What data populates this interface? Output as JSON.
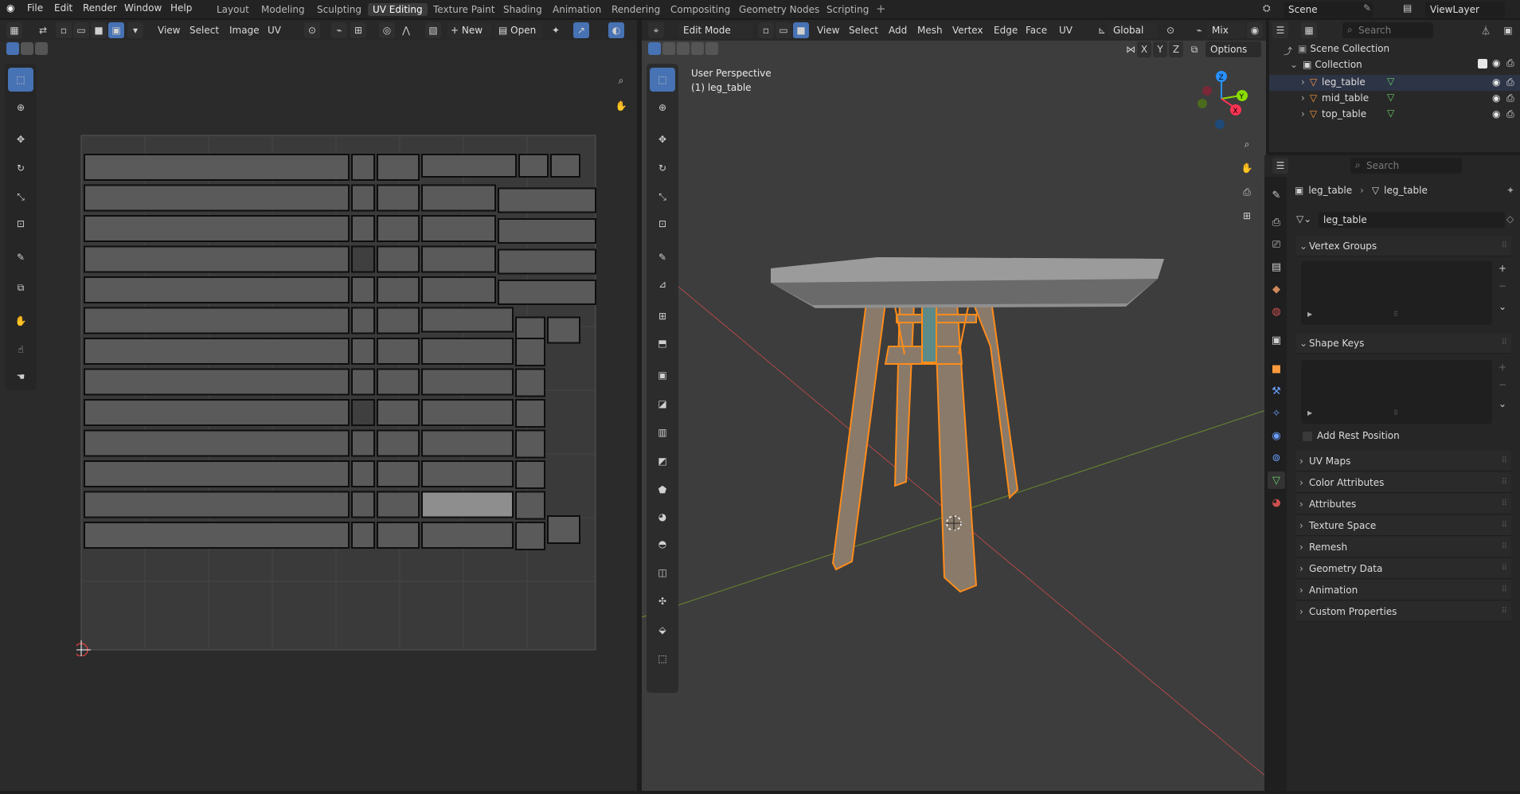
{
  "topbar": {
    "menus": [
      "File",
      "Edit",
      "Render",
      "Window",
      "Help"
    ],
    "workspaces": [
      "Layout",
      "Modeling",
      "Sculpting",
      "UV Editing",
      "Texture Paint",
      "Shading",
      "Animation",
      "Rendering",
      "Compositing",
      "Geometry Nodes",
      "Scripting"
    ],
    "active_workspace": "UV Editing",
    "scene": "Scene",
    "view_layer": "ViewLayer"
  },
  "uv_editor": {
    "menus": [
      "View",
      "Select",
      "Image",
      "UV"
    ],
    "new_label": "New",
    "open_label": "Open"
  },
  "viewport": {
    "mode": "Edit Mode",
    "menus": [
      "View",
      "Select",
      "Add",
      "Mesh",
      "Vertex",
      "Edge",
      "Face",
      "UV"
    ],
    "transform_orientation": "Global",
    "snap_mode": "Mix",
    "options_label": "Options",
    "axes": [
      "X",
      "Y",
      "Z"
    ],
    "overlay_title": "User Perspective",
    "overlay_object": "(1) leg_table",
    "gizmo_axes": [
      "X",
      "Y",
      "Z"
    ]
  },
  "outliner": {
    "search_placeholder": "Search",
    "root": "Scene Collection",
    "collection": "Collection",
    "objects": [
      "leg_table",
      "mid_table",
      "top_table"
    ]
  },
  "properties": {
    "search_placeholder": "Search",
    "breadcrumb_object": "leg_table",
    "breadcrumb_data": "leg_table",
    "mesh_name": "leg_table",
    "vertex_groups_label": "Vertex Groups",
    "shape_keys_label": "Shape Keys",
    "add_rest_position_label": "Add Rest Position",
    "panels": [
      "UV Maps",
      "Color Attributes",
      "Attributes",
      "Texture Space",
      "Remesh",
      "Geometry Data",
      "Animation",
      "Custom Properties"
    ]
  },
  "colors": {
    "accent_blue": "#4772b3",
    "selection_orange": "#ff8c1a",
    "x_axis": "#ff3352",
    "y_axis": "#8bdc00",
    "z_axis": "#2890ff"
  }
}
